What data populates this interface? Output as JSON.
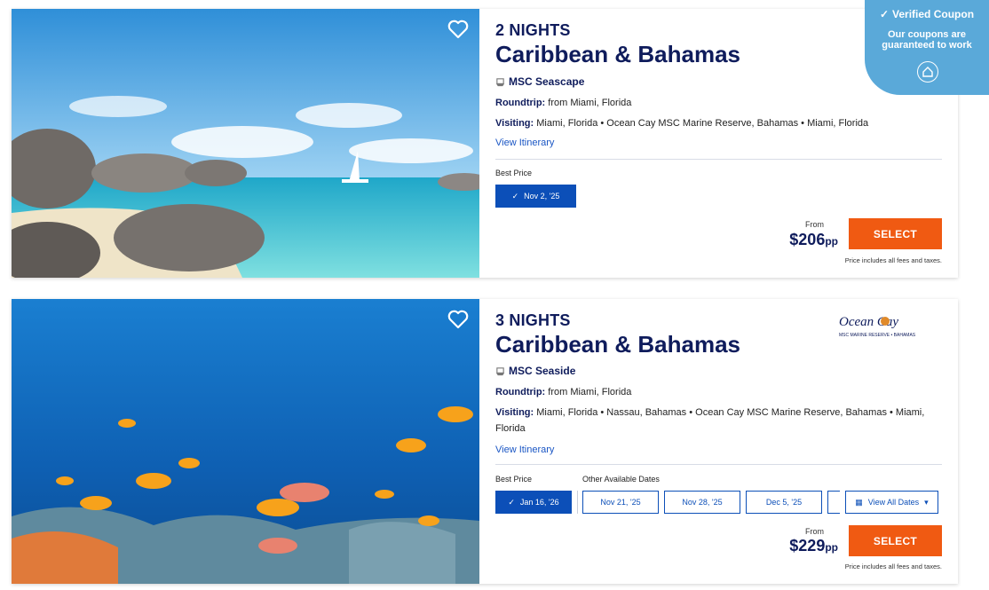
{
  "cruises": [
    {
      "nights": "2 NIGHTS",
      "title": "Caribbean & Bahamas",
      "ship": "MSC Seascape",
      "roundtrip_label": "Roundtrip:",
      "roundtrip": "from Miami, Florida",
      "visiting_label": "Visiting:",
      "visiting": "Miami, Florida • Ocean Cay MSC Marine Reserve, Bahamas • Miami, Florida",
      "view_itinerary": "View Itinerary",
      "best_price_label": "Best Price",
      "selected_date": "Nov 2, '25",
      "from_label": "From",
      "price": "$206",
      "price_unit": "pp",
      "select_label": "SELECT",
      "fees_note": "Price includes all fees and taxes."
    },
    {
      "nights": "3 NIGHTS",
      "title": "Caribbean & Bahamas",
      "ship": "MSC Seaside",
      "roundtrip_label": "Roundtrip:",
      "roundtrip": "from Miami, Florida",
      "visiting_label": "Visiting:",
      "visiting": "Miami, Florida • Nassau, Bahamas • Ocean Cay MSC Marine Reserve, Bahamas • Miami, Florida",
      "view_itinerary": "View Itinerary",
      "best_price_label": "Best Price",
      "other_dates_label": "Other Available Dates",
      "selected_date": "Jan 16, '26",
      "other_dates": [
        "Nov 21, '25",
        "Nov 28, '25",
        "Dec 5, '25"
      ],
      "view_all_dates": "View All Dates",
      "from_label": "From",
      "price": "$229",
      "price_unit": "pp",
      "select_label": "SELECT",
      "fees_note": "Price includes all fees and taxes.",
      "logo_text": "Ocean Cay",
      "logo_sub": "MSC MARINE RESERVE • BAHAMAS"
    }
  ],
  "coupon": {
    "title": "Verified Coupon",
    "subtitle": "Our coupons are guaranteed to work"
  },
  "colors": {
    "navy": "#0f1c5c",
    "accent_blue": "#0c4fb8",
    "select_orange": "#f05a12",
    "coupon_blue": "#5aa9d9"
  }
}
